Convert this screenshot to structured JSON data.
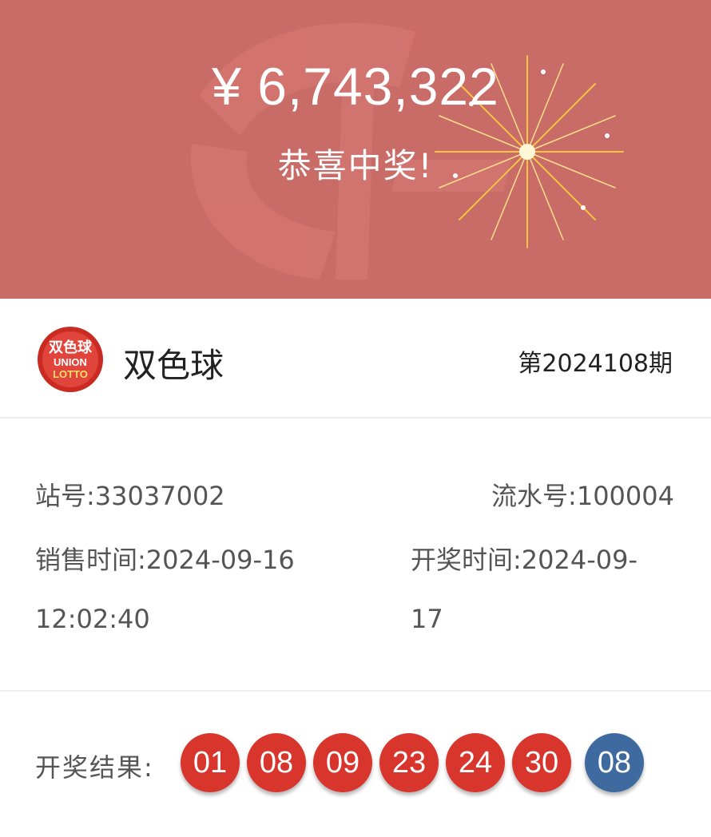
{
  "banner": {
    "amount": "¥ 6,743,322",
    "congrats": "恭喜中奖!"
  },
  "lottery": {
    "name": "双色球",
    "issue": "第2024108期",
    "logo_text_cn": "双色球",
    "logo_text_en_1": "UNION",
    "logo_text_en_2": "LOTTO"
  },
  "info": {
    "station": "站号:33037002",
    "serial": "流水号:100004",
    "sale_time_line1": "销售时间:2024-09-16",
    "sale_time_line2": "12:02:40",
    "draw_time_line1": "开奖时间:2024-09-",
    "draw_time_line2": "17"
  },
  "result": {
    "label": "开奖结果:",
    "red_balls": [
      "01",
      "08",
      "09",
      "23",
      "24",
      "30"
    ],
    "blue_ball": "08"
  },
  "colors": {
    "banner": "#c96b67",
    "red_ball": "#d8352d",
    "blue_ball": "#3f6a9f"
  }
}
